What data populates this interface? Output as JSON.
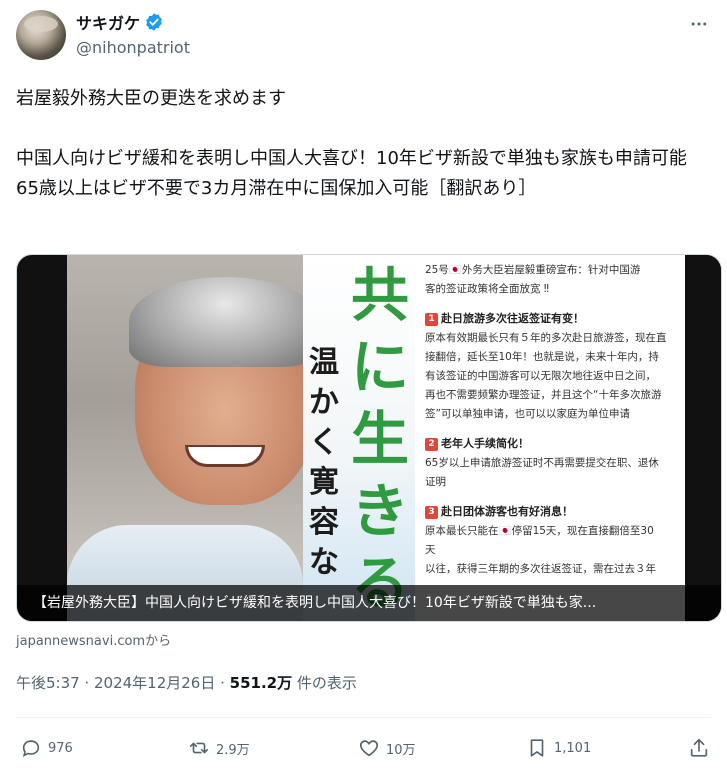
{
  "author": {
    "display_name": "サキガケ",
    "handle": "@nihonpatriot"
  },
  "tweet": {
    "text": "岩屋毅外務大臣の更迭を求めます\n\n中国人向けビザ緩和を表明し中国人大喜び！10年ビザ新設で単独も家族も申請可能　65歳以上はビザ不要で3カ月滞在中に国保加入可能［翻訳あり］"
  },
  "media": {
    "poster_big": "共に生きる",
    "poster_small": "温かく寛容な",
    "notes": {
      "line1": "25号🇯🇵外务大臣岩屋毅重磅宣布：针对中国游",
      "line2": "客的签证政策将全面放宽 ‼",
      "head1": "赴日旅游多次往返签证有变！",
      "body1": [
        "原本有效期最长只有５年的多次赴日旅游签，现在直",
        "接翻倍，延长至10年！也就是说，未来十年内，持",
        "有该签证的中国游客可以无限次地往返中日之间，",
        "再也不需要频繁办理签证，并且这个“十年多次旅游",
        "签”可以单独申请，也可以以家庭为单位申请"
      ],
      "head2": "老年人手续简化！",
      "body2": [
        "65岁以上申请旅游签证时不再需要提交在职、退休",
        "证明"
      ],
      "head3": "赴日团体游客也有好消息！",
      "body3": [
        "原本最长只能在🇯🇵停留15天，现在直接翻倍至30",
        "天"
      ],
      "tail": "以往，获得三年期的多次往返签证，需在过去３年"
    },
    "caption": "【岩屋外務大臣】中国人向けビザ緩和を表明し中国人大喜び！10年ビザ新設で単独も家..."
  },
  "source": "japannewsnavi.comから",
  "meta": {
    "time_date": "午後5:37 · 2024年12月26日 · ",
    "views": "551.2万",
    "views_suffix": " 件の表示"
  },
  "actions": {
    "replies": "976",
    "reposts": "2.9万",
    "likes": "10万",
    "bookmarks": "1,101"
  },
  "colors": {
    "verified": "#1d9bf0",
    "secondary_text": "#536471",
    "poster_green": "#2f9a3f"
  }
}
